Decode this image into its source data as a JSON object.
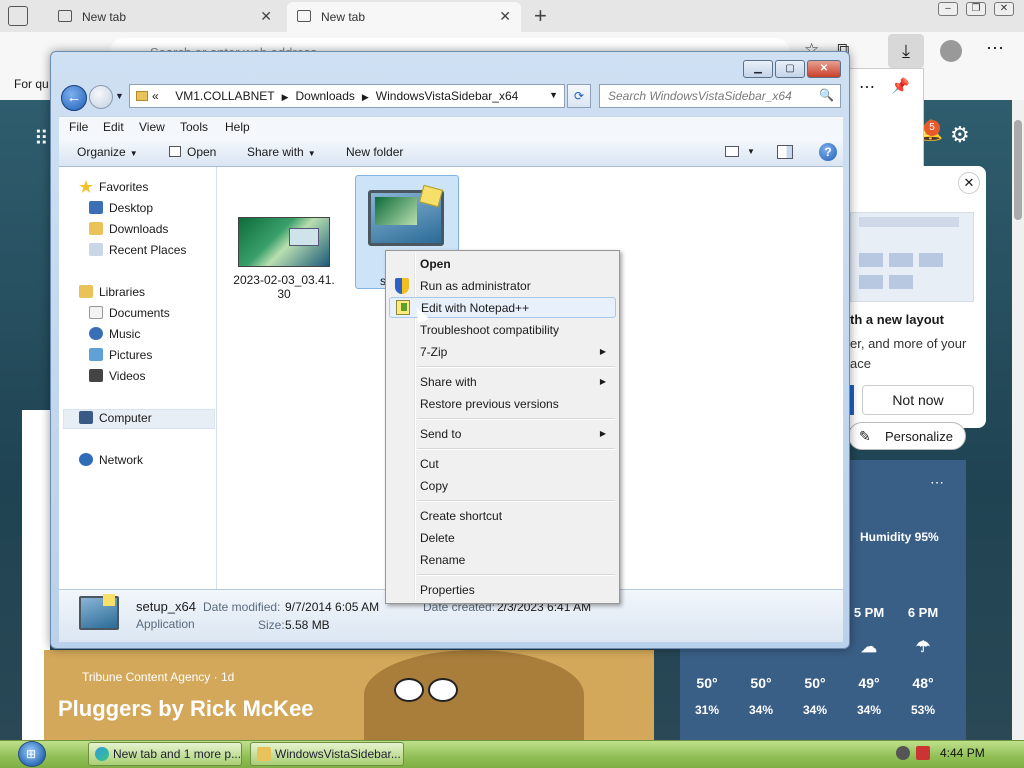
{
  "browser": {
    "tabs": [
      {
        "label": "New tab"
      },
      {
        "label": "New tab"
      }
    ],
    "address_placeholder": "Search or enter web address",
    "favorites_label": "For qu",
    "notification_count": "5",
    "promo": {
      "title": "th a new layout",
      "text": "er, and more of your ace",
      "not_now": "Not now",
      "personalize": "Personalize"
    },
    "weather": {
      "humidity": "Humidity 95%",
      "hours": [
        {
          "time": "",
          "temp": "50°",
          "precip": "31%"
        },
        {
          "time": "",
          "temp": "50°",
          "precip": "34%"
        },
        {
          "time": "",
          "temp": "50°",
          "precip": "34%"
        },
        {
          "time": "5 PM",
          "temp": "49°",
          "precip": "34%"
        },
        {
          "time": "6 PM",
          "temp": "48°",
          "precip": "53%"
        }
      ]
    },
    "comic": {
      "source": "Tribune Content Agency · 1d",
      "title": "Pluggers by Rick McKee"
    }
  },
  "explorer": {
    "breadcrumb": [
      "«",
      "VM1.COLLABNET",
      "Downloads",
      "WindowsVistaSidebar_x64"
    ],
    "search_placeholder": "Search WindowsVistaSidebar_x64",
    "menu": [
      "File",
      "Edit",
      "View",
      "Tools",
      "Help"
    ],
    "commands": {
      "organize": "Organize",
      "open": "Open",
      "share_with": "Share with",
      "new_folder": "New folder"
    },
    "nav": {
      "favorites": "Favorites",
      "desktop": "Desktop",
      "downloads": "Downloads",
      "recent": "Recent Places",
      "libraries": "Libraries",
      "documents": "Documents",
      "music": "Music",
      "pictures": "Pictures",
      "videos": "Videos",
      "computer": "Computer",
      "network": "Network"
    },
    "files": [
      {
        "name": "2023-02-03_03.41.30",
        "line1": "2023-02-03_03.41.",
        "line2": "30"
      },
      {
        "name": "s",
        "line1": "s"
      }
    ],
    "details": {
      "name": "setup_x64",
      "type": "Application",
      "modified_label": "Date modified:",
      "modified": "9/7/2014 6:05 AM",
      "created_label": "Date created:",
      "created": "2/3/2023 6:41 AM",
      "size_label": "Size:",
      "size": "5.58 MB"
    }
  },
  "context_menu": {
    "items": [
      {
        "label": "Open"
      },
      {
        "label": "Run as administrator"
      },
      {
        "label": "Edit with Notepad++"
      },
      {
        "label": "Troubleshoot compatibility"
      },
      {
        "label": "7-Zip"
      },
      {
        "label": "Share with"
      },
      {
        "label": "Restore previous versions"
      },
      {
        "label": "Send to"
      },
      {
        "label": "Cut"
      },
      {
        "label": "Copy"
      },
      {
        "label": "Create shortcut"
      },
      {
        "label": "Delete"
      },
      {
        "label": "Rename"
      },
      {
        "label": "Properties"
      }
    ]
  },
  "taskbar": {
    "items": [
      {
        "label": "New tab and 1 more p..."
      },
      {
        "label": "WindowsVistaSidebar..."
      }
    ],
    "clock": "4:44 PM"
  },
  "colors": {
    "accent": "#1f5eb8",
    "taskbar": "#8fbf55",
    "menu_hover": "#e8f0fb"
  }
}
